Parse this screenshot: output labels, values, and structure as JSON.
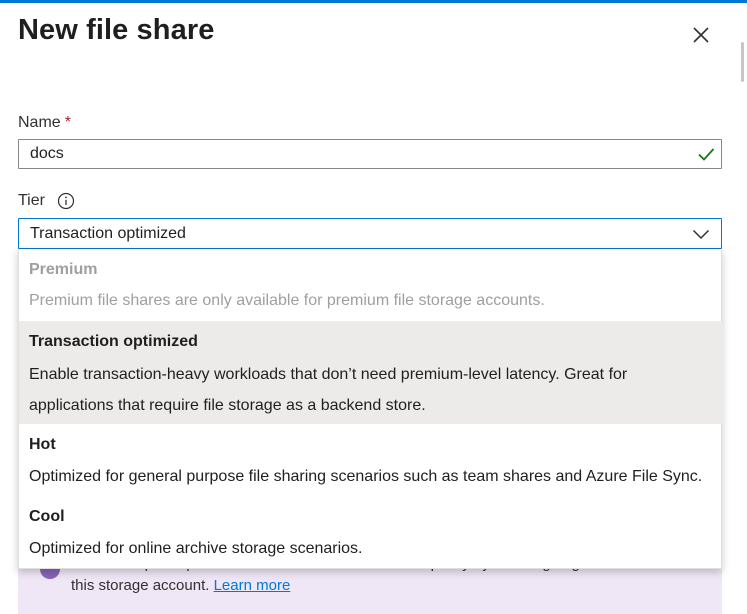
{
  "panel": {
    "title": "New file share"
  },
  "form": {
    "name_label": "Name",
    "name_required_marker": "*",
    "name_value": "docs",
    "tier_label": "Tier",
    "tier_value": "Transaction optimized"
  },
  "tier_options": [
    {
      "name": "Premium",
      "description": "Premium file shares are only available for premium file storage accounts.",
      "disabled": true,
      "selected": false
    },
    {
      "name": "Transaction optimized",
      "description_line1": "Enable transaction-heavy workloads that don’t need premium-level latency. Great for",
      "description_line2": "applications that require file storage as a backend store.",
      "disabled": false,
      "selected": true
    },
    {
      "name": "Hot",
      "description": "Optimized for general purpose file sharing scenarios such as team shares and Azure File Sync.",
      "disabled": false,
      "selected": false
    },
    {
      "name": "Cool",
      "description": "Optimized for online archive storage scenarios.",
      "disabled": false,
      "selected": false
    }
  ],
  "banner": {
    "text_line1": "You can improve performance and maximum share capacity by enabling large file shares for",
    "text_line2": "this storage account.",
    "link": "Learn more"
  },
  "icons": {
    "close": "close-icon",
    "valid": "checkmark-icon",
    "info": "info-icon",
    "dropdown": "chevron-down-icon",
    "banner": "info-icon"
  },
  "colors": {
    "accent": "#0078d4",
    "valid": "#107c10",
    "required": "#a4262c",
    "selected_bg": "#edebe9",
    "disabled_text": "#a19f9d",
    "banner_bg": "#efe6f6"
  }
}
